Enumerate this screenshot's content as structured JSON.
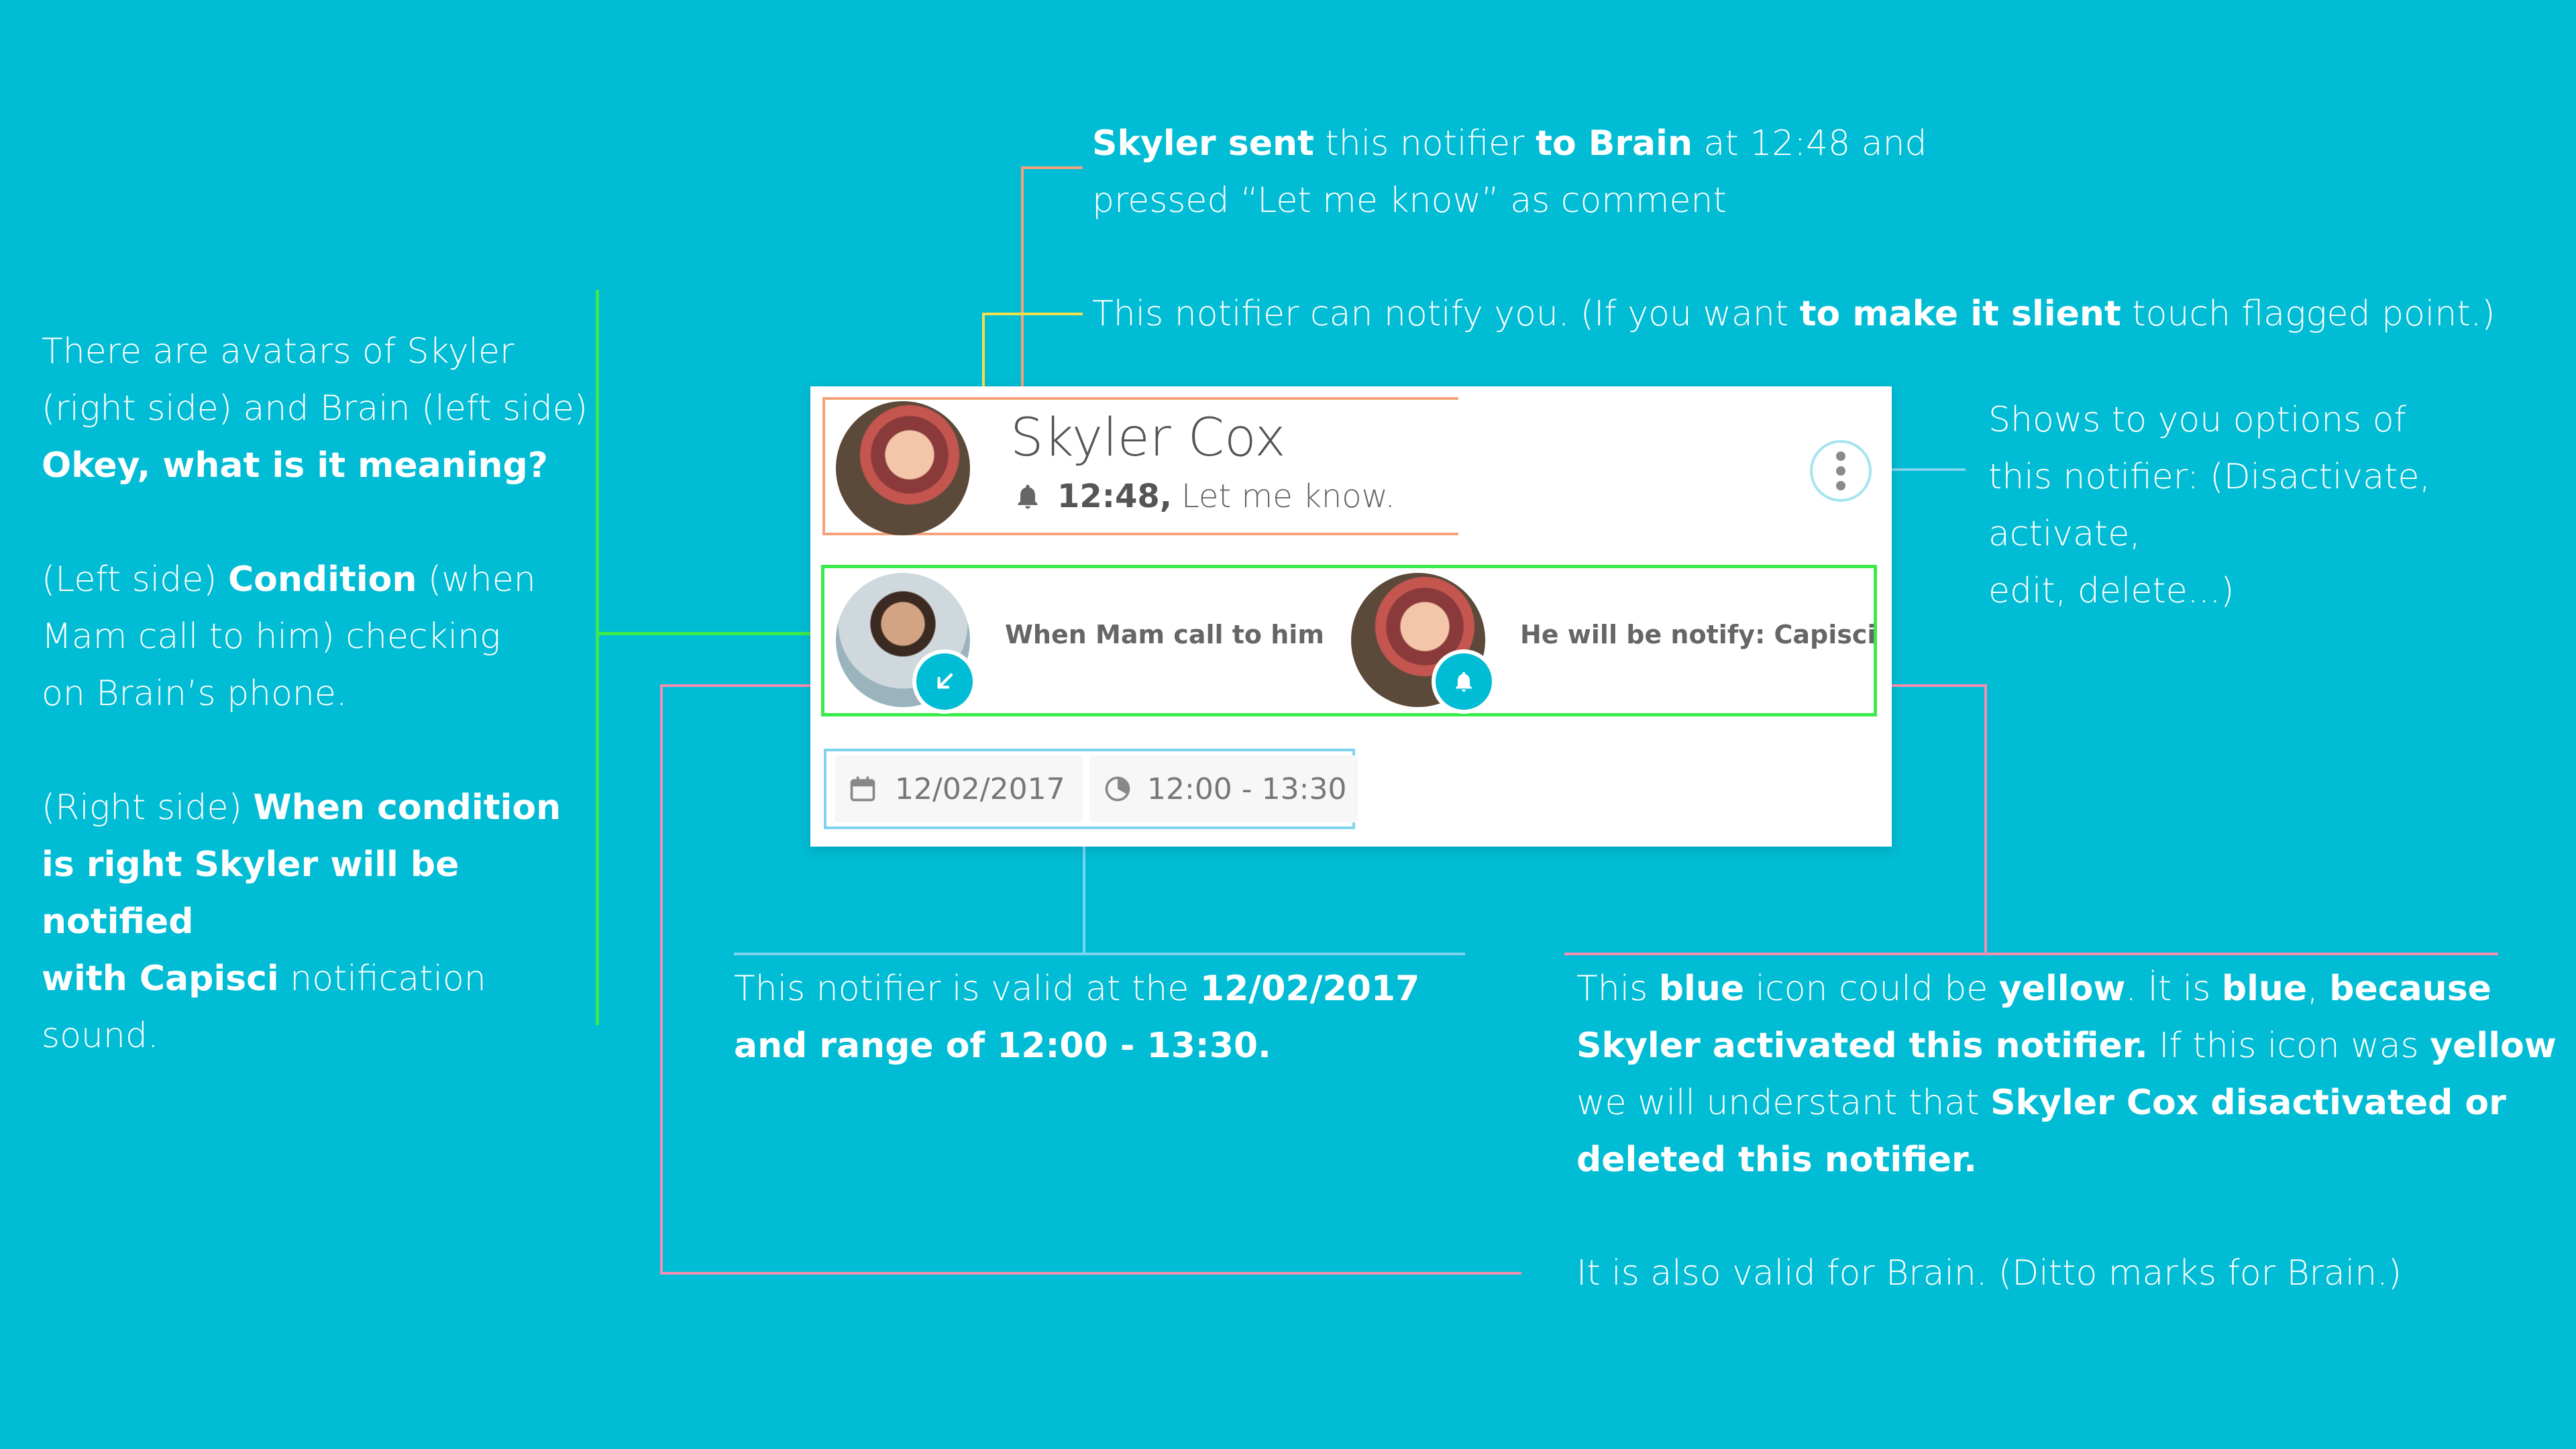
{
  "card": {
    "name": "Skyler Cox",
    "time": "12:48,",
    "comment": "Let me know.",
    "condition_label": "When Mam call to him",
    "action_label": "He will be notify: Capisci",
    "date": "12/02/2017",
    "time_range": "12:00 - 13:30"
  },
  "annotations": {
    "top": {
      "p1": "Skyler sent",
      "p2": " this notifier ",
      "p3": "to Brain",
      "p4": " at 12:48 and",
      "p5": "pressed “Let me know” as comment"
    },
    "notify": {
      "p1": "This notifier can notify you. (If you want ",
      "p2": "to make it slient",
      "p3": " touch flagged point.)"
    },
    "options": {
      "l1": "Shows to you options of",
      "l2": "this notifier: (Disactivate, activate,",
      "l3": "edit, delete...)"
    },
    "left": {
      "l1": "There are avatars of Skyler",
      "l2": "(right side) and Brain (left side)",
      "l3": "Okey, what is it meaning?",
      "l4a": "(Left side) ",
      "l4b": "Condition",
      "l4c": " (when",
      "l5": "Mam call to him) checking",
      "l6": "on Brain’s phone.",
      "l7a": "(Right side) ",
      "l7b": "When condition",
      "l8": "is right Skyler will be notified",
      "l9a": "with Capisci",
      "l9b": " notification sound."
    },
    "valid": {
      "p1": "This notifier is valid at the ",
      "p2": "12/02/2017",
      "p3": "and range of 12:00 - 13:30."
    },
    "blue": {
      "a1": "This ",
      "a2": "blue",
      "a3": " icon could be ",
      "a4": "yellow",
      "a5": ". İt is ",
      "a6": "blue",
      "a7": ", ",
      "a8": "because",
      "b1": "Skyler activated this notifier.",
      "b2": " If this icon was ",
      "b3": "yellow",
      "c1": "we will understant that ",
      "c2": "Skyler Cox disactivated or",
      "d1": "deleted this notifier."
    },
    "brain": {
      "l1": "It is also valid for Brain. (Ditto marks for Brain.)"
    }
  },
  "colors": {
    "background": "#00BCD4",
    "orange": "#F5A27A",
    "yellow": "#F4E04D",
    "green": "#3BEA4B",
    "blue": "#7ED4F0",
    "pink": "#F48FB1"
  }
}
